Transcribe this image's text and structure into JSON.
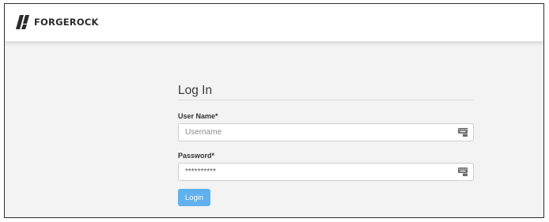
{
  "header": {
    "brand": "FORGEROCK",
    "logo_icon": "forgerock-logo-icon"
  },
  "login_form": {
    "title": "Log In",
    "username": {
      "label": "User Name*",
      "placeholder": "Username",
      "value": "",
      "icon": "keyboard-icon"
    },
    "password": {
      "label": "Password*",
      "placeholder": "",
      "value": "**********",
      "icon": "keyboard-icon"
    },
    "submit_label": "Login"
  },
  "colors": {
    "background": "#f3f3f3",
    "header_bg": "#ffffff",
    "button_bg": "#60b1ed",
    "button_text": "#ffffff"
  }
}
